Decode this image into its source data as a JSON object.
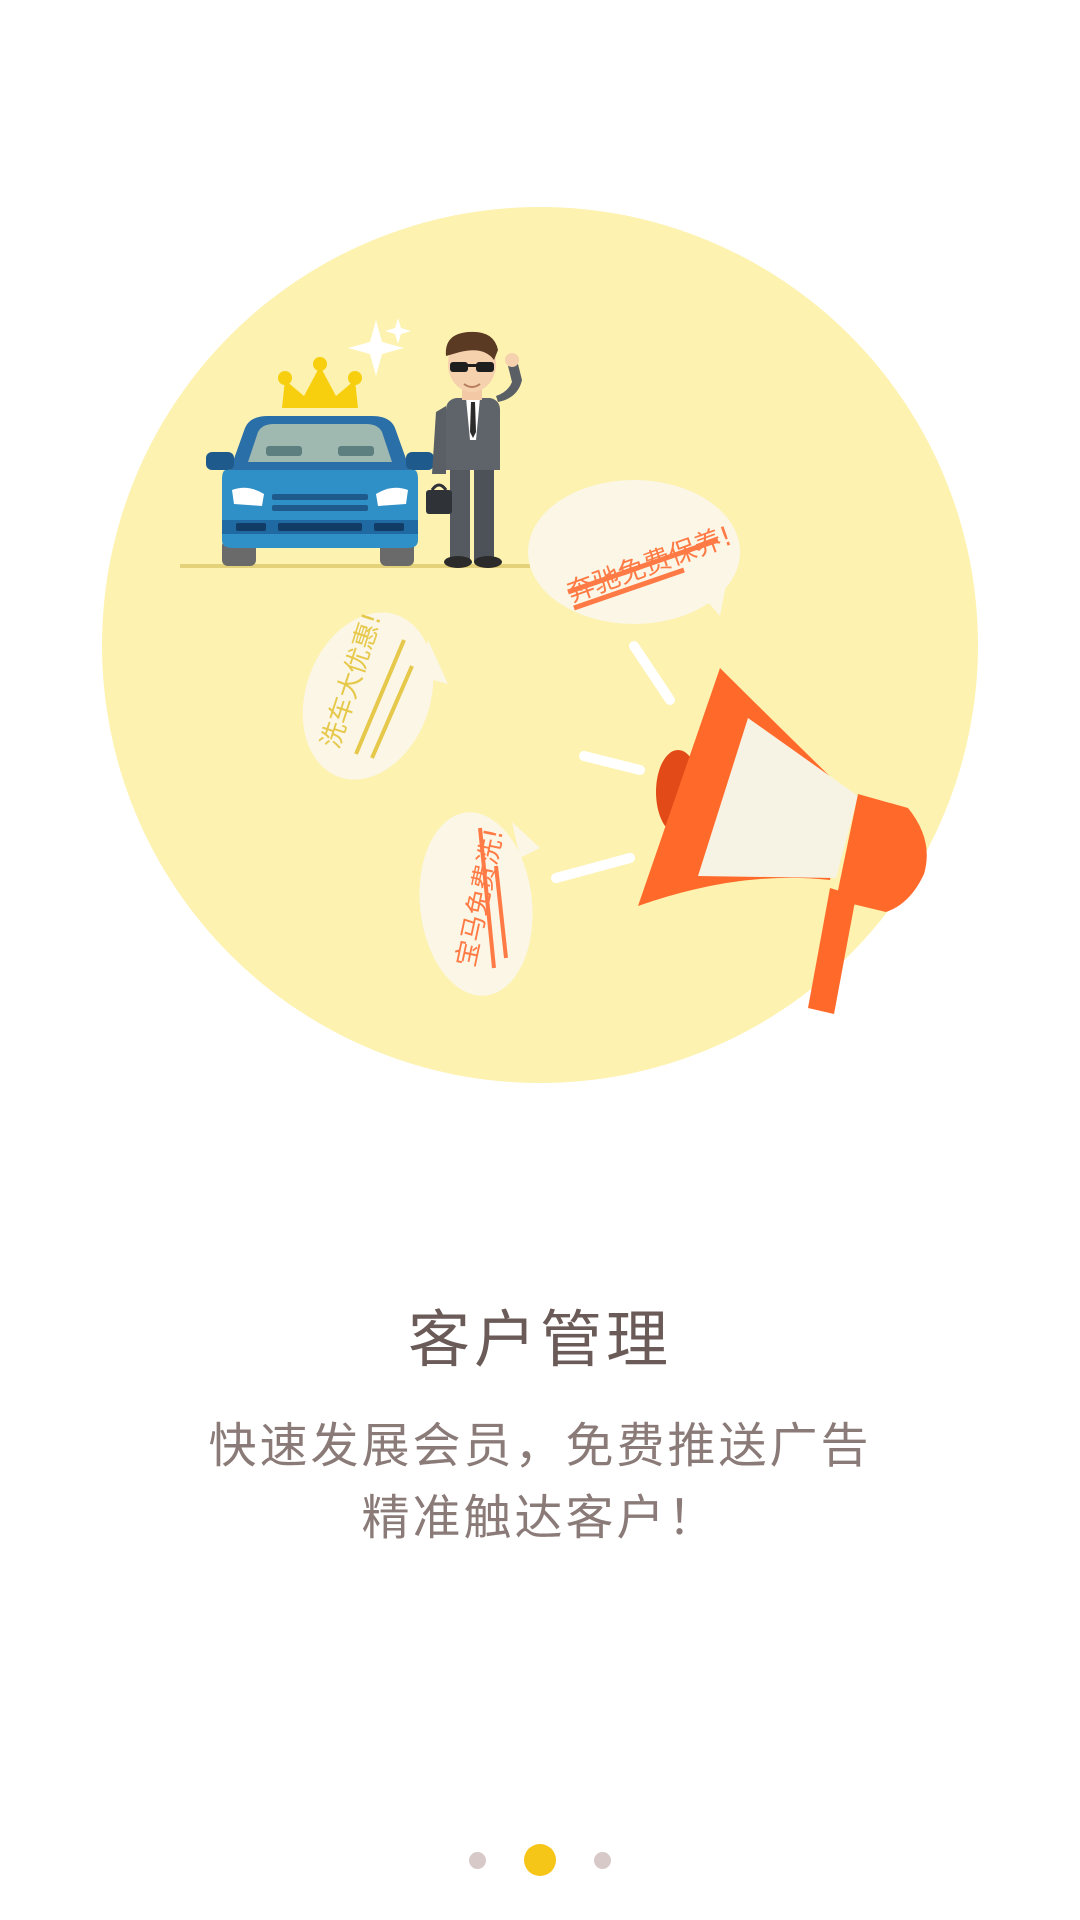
{
  "illustration": {
    "bubble_1": "奔驰免费保养!",
    "bubble_2": "洗车大优惠!",
    "bubble_3": "宝马免费洗!"
  },
  "onboarding": {
    "title": "客户管理",
    "subtitle_line1": "快速发展会员，免费推送广告",
    "subtitle_line2": "精准触达客户！"
  },
  "pager": {
    "pages": 3,
    "active_index": 1
  },
  "colors": {
    "circle": "#fdf2b0",
    "accent_orange": "#ff6a2b",
    "active_dot": "#f5c518",
    "inactive_dot": "#d6c9c7"
  }
}
